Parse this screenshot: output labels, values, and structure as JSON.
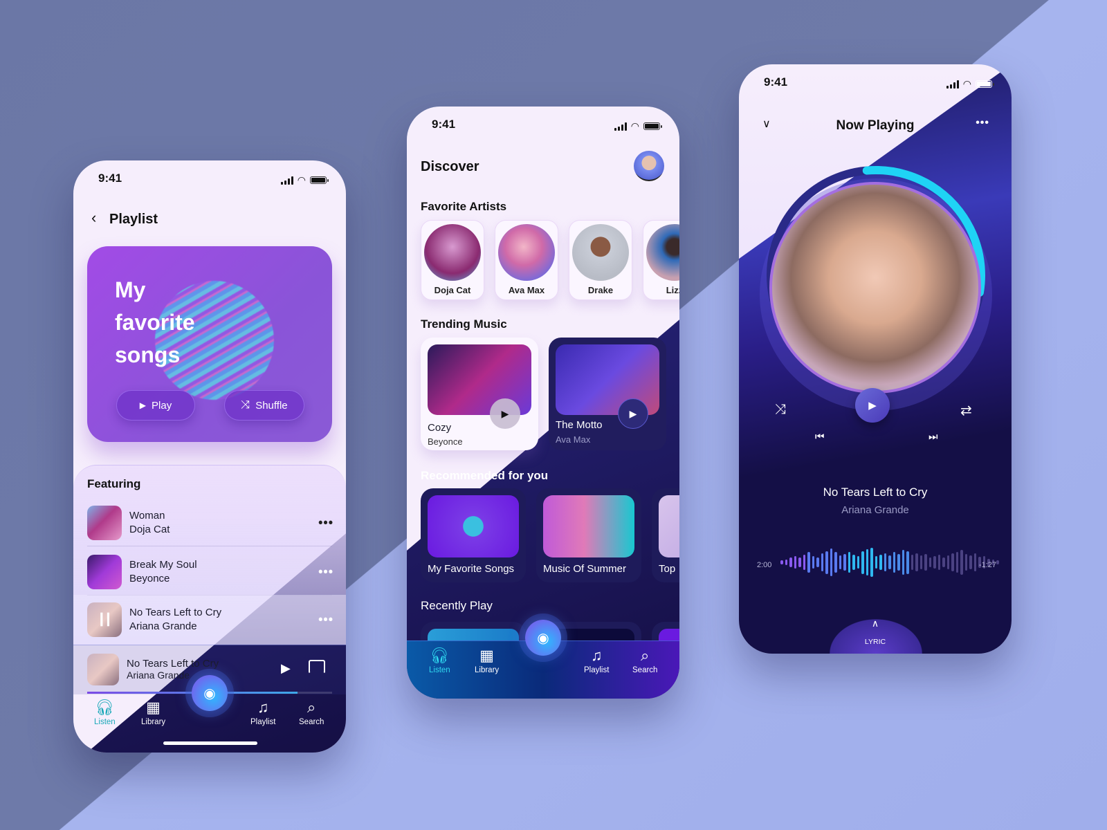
{
  "colors": {
    "accent_cyan": "#1fd3f5",
    "accent_purple": "#8a54d8",
    "dark_bg": "#150f44",
    "light_bg": "#f6eefc",
    "active_tab_teal": "#1aa8b8"
  },
  "status_bar": {
    "time": "9:41",
    "icons": [
      "signal-icon",
      "wifi-icon",
      "battery-icon"
    ]
  },
  "playlist_screen": {
    "back_icon": "chevron-left-icon",
    "title": "Playlist",
    "hero": {
      "title": "My\nfavorite\nsongs",
      "play_label": "Play",
      "shuffle_label": "Shuffle"
    },
    "section_title": "Featuring",
    "tracks": [
      {
        "title": "Woman",
        "artist": "Doja Cat"
      },
      {
        "title": "Break My Soul",
        "artist": "Beyonce"
      },
      {
        "title": "No Tears Left to Cry",
        "artist": "Ariana Grande",
        "playing": true
      }
    ],
    "mini_player": {
      "title": "No Tears Left to Cry",
      "artist": "Ariana Grande",
      "progress": 0.86
    },
    "tabs": [
      {
        "label": "Listen",
        "icon": "headphones-icon",
        "active": true
      },
      {
        "label": "Library",
        "icon": "grid-icon"
      },
      {
        "label": "Playlist",
        "icon": "music-note-icon"
      },
      {
        "label": "Search",
        "icon": "search-icon"
      }
    ]
  },
  "discover_screen": {
    "title": "Discover",
    "favorite_artists_title": "Favorite Artists",
    "artists": [
      "Doja Cat",
      "Ava Max",
      "Drake",
      "Lizz"
    ],
    "trending_title": "Trending Music",
    "trending": [
      {
        "title": "Cozy",
        "artist": "Beyonce"
      },
      {
        "title": "The Motto",
        "artist": "Ava Max"
      }
    ],
    "recommended_title": "Recommended for you",
    "recommended": [
      "My Favorite Songs",
      "Music Of Summer",
      "Top"
    ],
    "recently_title": "Recently Play",
    "tabs": [
      {
        "label": "Listen",
        "icon": "headphones-icon",
        "active": true
      },
      {
        "label": "Library",
        "icon": "grid-icon"
      },
      {
        "label": "Playlist",
        "icon": "music-note-icon"
      },
      {
        "label": "Search",
        "icon": "search-icon"
      }
    ]
  },
  "now_playing_screen": {
    "title": "Now Playing",
    "song": "No Tears Left to Cry",
    "artist": "Ariana Grande",
    "elapsed": "2:00",
    "remaining": "-1:27",
    "progress": 0.58,
    "lyric_label": "LYRIC"
  }
}
